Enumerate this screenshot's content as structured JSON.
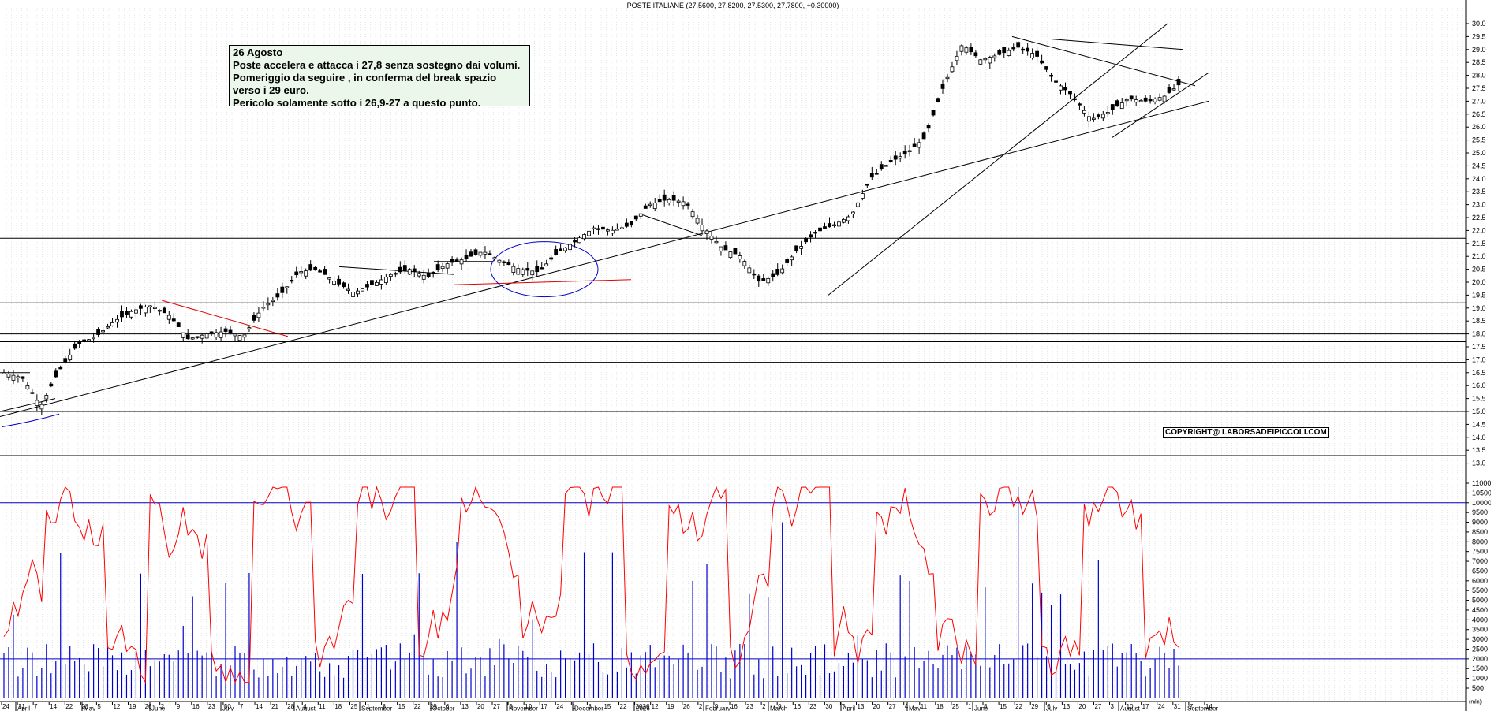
{
  "chart_data": [
    {
      "type": "candlestick",
      "title": "POSTE ITALIANE (27.5600, 27.8200, 27.5300, 27.7800, +0.30000)",
      "ylim": [
        12.5,
        30.5
      ],
      "y_ticks": [
        "13.0",
        "13.5",
        "14.0",
        "14.5",
        "15.0",
        "15.5",
        "16.0",
        "16.5",
        "17.0",
        "17.5",
        "18.0",
        "18.5",
        "19.0",
        "19.5",
        "20.0",
        "20.5",
        "21.0",
        "21.5",
        "22.0",
        "22.5",
        "23.0",
        "23.5",
        "24.0",
        "24.5",
        "25.0",
        "25.5",
        "26.0",
        "26.5",
        "27.0",
        "27.5",
        "28.0",
        "28.5",
        "29.0",
        "29.5",
        "30.0"
      ],
      "price_path": [
        [
          "April 1",
          16.5
        ],
        [
          "April 7",
          16.3
        ],
        [
          "April 9",
          15.2
        ],
        [
          "April 14",
          16.6
        ],
        [
          "April 22",
          17.6
        ],
        [
          "May 1",
          17.9
        ],
        [
          "May 12",
          18.5
        ],
        [
          "May 22",
          18.9
        ],
        [
          "June 2",
          19.1
        ],
        [
          "June 13",
          18.7
        ],
        [
          "June 20",
          17.8
        ],
        [
          "July 1",
          18.0
        ],
        [
          "July 14",
          18.1
        ],
        [
          "July 24",
          17.9
        ],
        [
          "August 1",
          19.0
        ],
        [
          "August 11",
          19.5
        ],
        [
          "August 22",
          20.4
        ],
        [
          "August 28",
          20.5
        ],
        [
          "September 2",
          20.0
        ],
        [
          "September 10",
          19.6
        ],
        [
          "September 20",
          19.9
        ],
        [
          "September 30",
          20.3
        ],
        [
          "October 10",
          20.5
        ],
        [
          "October 20",
          20.2
        ],
        [
          "October 31",
          20.7
        ],
        [
          "November 7",
          20.9
        ],
        [
          "November 12",
          21.2
        ],
        [
          "November 20",
          20.8
        ],
        [
          "December 1",
          20.5
        ],
        [
          "December 10",
          20.4
        ],
        [
          "December 20",
          21.1
        ],
        [
          "January 2",
          21.6
        ],
        [
          "January 12",
          22.1
        ],
        [
          "January 22",
          22.0
        ],
        [
          "February 2",
          22.2
        ],
        [
          "February 10",
          23.0
        ],
        [
          "February 20",
          23.2
        ],
        [
          "February 27",
          23.1
        ],
        [
          "March 4",
          22.1
        ],
        [
          "March 10",
          21.3
        ],
        [
          "March 16",
          21.0
        ],
        [
          "March 22",
          20.0
        ],
        [
          "March 30",
          20.3
        ],
        [
          "April 4",
          21.2
        ],
        [
          "April 14",
          21.9
        ],
        [
          "April 24",
          22.2
        ],
        [
          "May 1",
          22.6
        ],
        [
          "May 8",
          24.0
        ],
        [
          "May 18",
          24.6
        ],
        [
          "May 28",
          25.0
        ],
        [
          "June 3",
          25.6
        ],
        [
          "June 9",
          27.6
        ],
        [
          "June 16",
          29.2
        ],
        [
          "June 22",
          28.6
        ],
        [
          "June 30",
          28.8
        ],
        [
          "July 6",
          29.1
        ],
        [
          "July 12",
          28.8
        ],
        [
          "July 18",
          27.8
        ],
        [
          "July 24",
          27.2
        ],
        [
          "July 30",
          26.3
        ],
        [
          "August 5",
          26.6
        ],
        [
          "August 11",
          27.1
        ],
        [
          "August 17",
          27.0
        ],
        [
          "August 21",
          27.2
        ],
        [
          "August 26",
          27.78
        ]
      ],
      "x_tick_labels": [
        "24",
        "31",
        "7",
        "14",
        "22",
        "28",
        "5",
        "12",
        "19",
        "26",
        "2",
        "9",
        "16",
        "23",
        "30",
        "7",
        "14",
        "21",
        "28",
        "4",
        "11",
        "18",
        "25",
        "1",
        "8",
        "15",
        "22",
        "29",
        "6",
        "13",
        "20",
        "27",
        "3",
        "10",
        "17",
        "24",
        "1",
        "8",
        "15",
        "22",
        "2026",
        "12",
        "19",
        "26",
        "2",
        "9",
        "16",
        "23",
        "2",
        "9",
        "16",
        "23",
        "30",
        "7",
        "13",
        "20",
        "27",
        "4",
        "11",
        "18",
        "25",
        "1",
        "8",
        "15",
        "22",
        "29",
        "6",
        "13",
        "20",
        "27",
        "3",
        "10",
        "17",
        "24",
        "31",
        "7",
        "14"
      ],
      "month_labels": [
        "April",
        "May",
        "June",
        "July",
        "August",
        "September",
        "October",
        "November",
        "December",
        "2026",
        "February",
        "March",
        "April",
        "May",
        "June",
        "July",
        "August",
        "September"
      ],
      "support_levels": [
        17.7,
        18.0,
        19.2,
        20.9,
        21.7,
        15.0,
        16.9
      ],
      "annotations": [
        "26 Agosto",
        "Poste accelera e attacca i 27,8 senza sostegno dai volumi.",
        "Pomeriggio da seguire , in conferma del break spazio",
        "verso i 29 euro.",
        "Pericolo solamente sotto i 26,9-27 a questo punto."
      ],
      "copyright": "COPYRIGHT@ LABORSADEIPICCOLI.COM"
    },
    {
      "type": "bar+line",
      "series": [
        {
          "values_desc": "volume"
        },
        {
          "values_desc": "oscillator"
        }
      ],
      "ylim": [
        0,
        11000
      ],
      "y_ticks": [
        "500",
        "1000",
        "1500",
        "2000",
        "2500",
        "3000",
        "3500",
        "4000",
        "4500",
        "5000",
        "5500",
        "6000",
        "6500",
        "7000",
        "7500",
        "8000",
        "8500",
        "9000",
        "9500",
        "10000",
        "10500",
        "11000"
      ],
      "y_unit": "(mln)",
      "reference_levels": [
        2000,
        10000
      ],
      "colors": {
        "volume": "#0000cc",
        "oscillator": "#ff0000",
        "ref": "#0000cc"
      }
    }
  ]
}
